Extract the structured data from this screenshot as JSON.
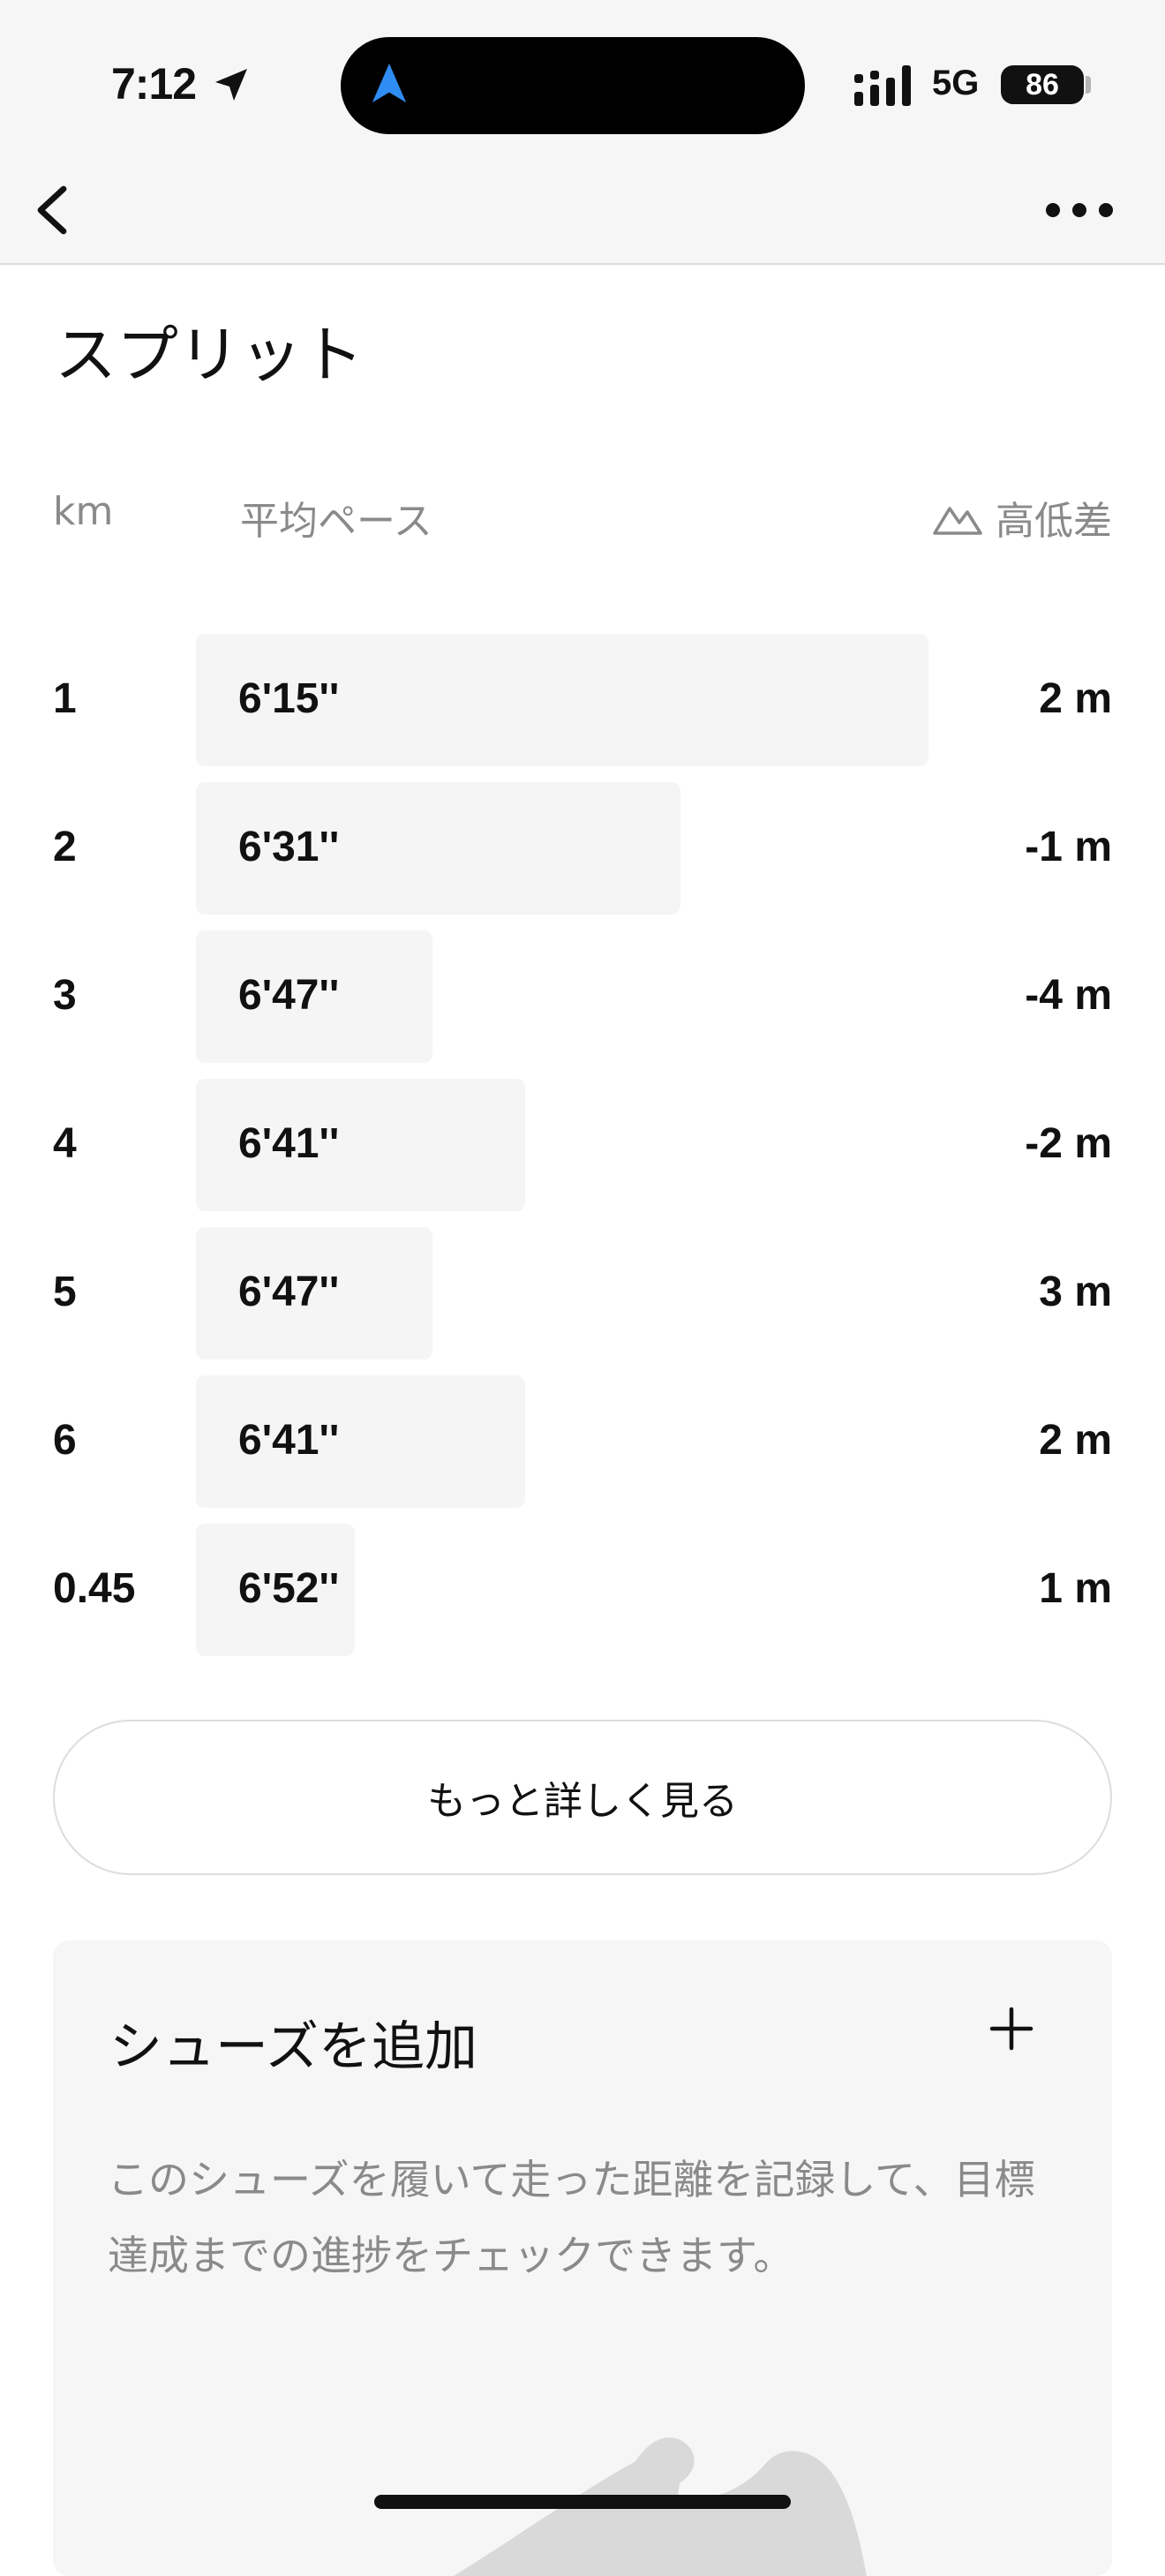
{
  "status_bar": {
    "time": "7:12",
    "network": "5G",
    "battery": "86"
  },
  "splits": {
    "title": "スプリット",
    "columns": {
      "km": "km",
      "pace": "平均ペース",
      "elevation": "高低差"
    },
    "max_pace_seconds": 412,
    "rows": [
      {
        "km": "1",
        "pace": "6'15''",
        "pace_seconds": 375,
        "elevation": "2 m"
      },
      {
        "km": "2",
        "pace": "6'31''",
        "pace_seconds": 391,
        "elevation": "-1 m"
      },
      {
        "km": "3",
        "pace": "6'47''",
        "pace_seconds": 407,
        "elevation": "-4 m"
      },
      {
        "km": "4",
        "pace": "6'41''",
        "pace_seconds": 401,
        "elevation": "-2 m"
      },
      {
        "km": "5",
        "pace": "6'47''",
        "pace_seconds": 407,
        "elevation": "3 m"
      },
      {
        "km": "6",
        "pace": "6'41''",
        "pace_seconds": 401,
        "elevation": "2 m"
      },
      {
        "km": "0.45",
        "pace": "6'52''",
        "pace_seconds": 412,
        "elevation": "1 m"
      }
    ],
    "detail_button": "もっと詳しく見る"
  },
  "shoes": {
    "title": "シューズを追加",
    "description": "このシューズを履いて走った距離を記録して、目標達成までの進捗をチェックできます。"
  },
  "colors": {
    "accent_blue": "#2f8cf2",
    "bar": "#f5f5f5",
    "muted_text": "#8a8a8a"
  }
}
